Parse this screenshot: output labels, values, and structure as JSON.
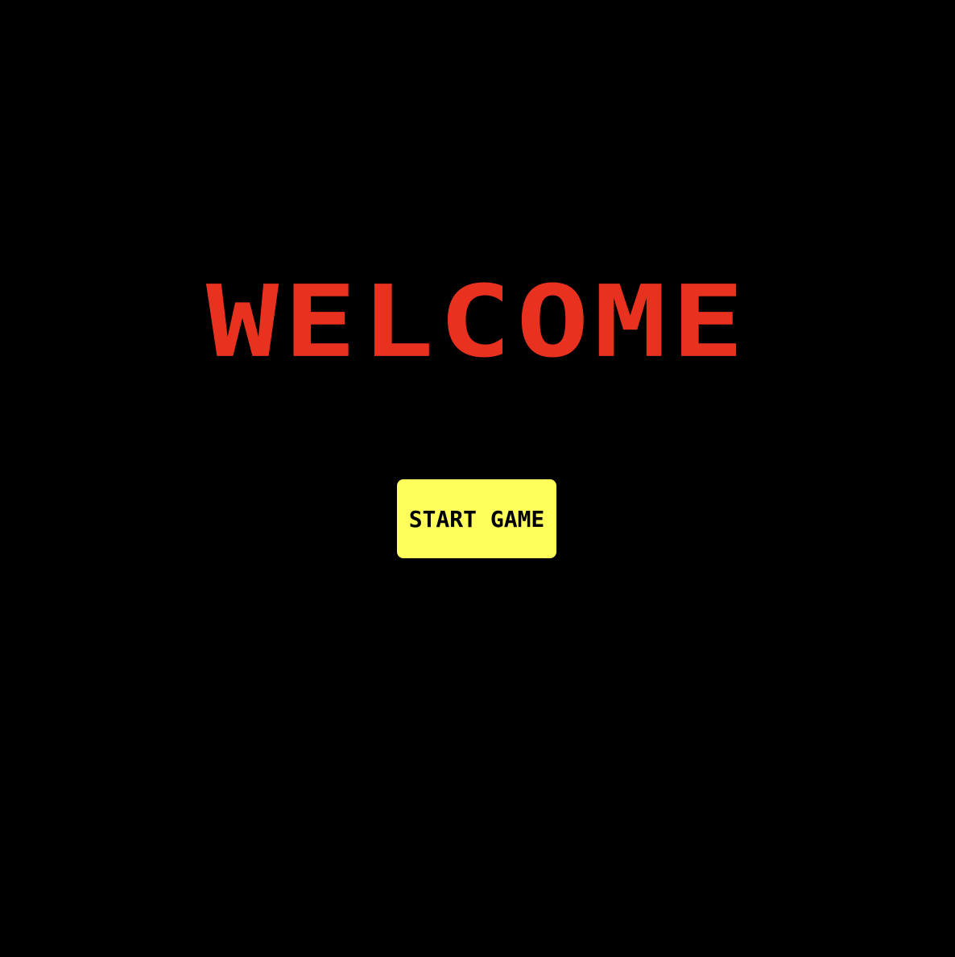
{
  "screen": {
    "background": "#000000"
  },
  "title": {
    "text": "WELCOME",
    "color": "#e8311f"
  },
  "start_button": {
    "label": "START GAME",
    "background": "#ffff5b"
  }
}
